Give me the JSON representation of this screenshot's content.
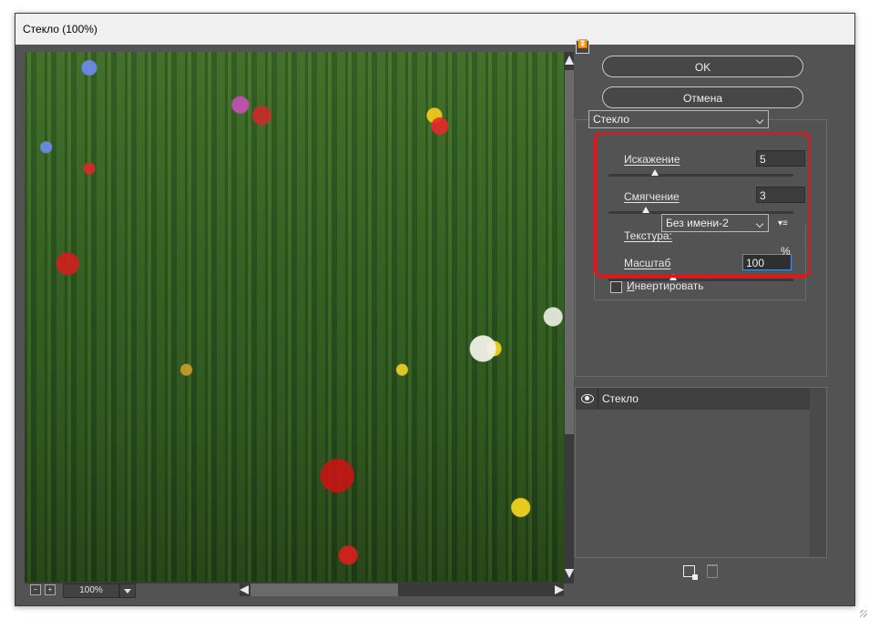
{
  "window": {
    "title": "Стекло (100%)"
  },
  "preview": {
    "zoom": "100%"
  },
  "buttons": {
    "ok": "OK",
    "cancel": "Отмена"
  },
  "filter": {
    "name": "Стекло",
    "distortion": {
      "label": "Искажение",
      "value": "5",
      "level": 0.25
    },
    "smoothing": {
      "label": "Смягчение",
      "value": "3",
      "level": 0.2
    },
    "texture": {
      "label": "Текстура:",
      "value": "Без имени-2"
    },
    "scale": {
      "label": "Масштаб",
      "value": "100",
      "unit": "%",
      "level": 0.35
    },
    "invert": {
      "label": "Инвертировать",
      "checked": false
    }
  },
  "layers": [
    {
      "name": "Стекло",
      "visible": true
    }
  ],
  "colors": {
    "panel": "#535353",
    "highlight": "#e3141a",
    "focus": "#4d8fd8"
  }
}
